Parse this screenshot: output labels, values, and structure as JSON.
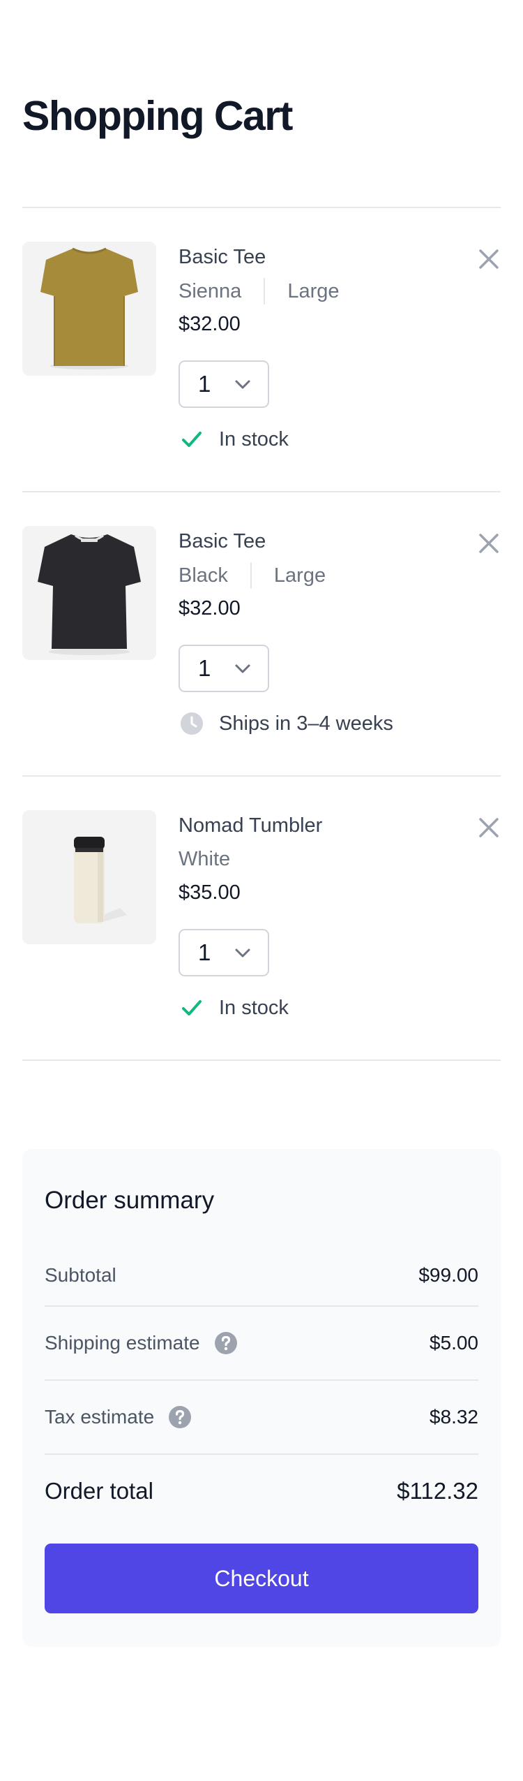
{
  "page": {
    "title": "Shopping Cart"
  },
  "cart": {
    "items": [
      {
        "name": "Basic Tee",
        "color": "Sienna",
        "size": "Large",
        "price": "$32.00",
        "quantity": "1",
        "availability": "In stock",
        "availability_icon": "check-icon",
        "image": "tshirt-sienna",
        "image_color": "#a58b3a"
      },
      {
        "name": "Basic Tee",
        "color": "Black",
        "size": "Large",
        "price": "$32.00",
        "quantity": "1",
        "availability": "Ships in 3–4 weeks",
        "availability_icon": "clock-icon",
        "image": "tshirt-black",
        "image_color": "#2a2a2e"
      },
      {
        "name": "Nomad Tumbler",
        "color": "White",
        "size": "",
        "price": "$35.00",
        "quantity": "1",
        "availability": "In stock",
        "availability_icon": "check-icon",
        "image": "tumbler-white",
        "image_color": "#efe9da"
      }
    ]
  },
  "summary": {
    "title": "Order summary",
    "subtotal_label": "Subtotal",
    "subtotal_value": "$99.00",
    "shipping_label": "Shipping estimate",
    "shipping_value": "$5.00",
    "tax_label": "Tax estimate",
    "tax_value": "$8.32",
    "total_label": "Order total",
    "total_value": "$112.32",
    "checkout_label": "Checkout"
  },
  "colors": {
    "accent": "#4f46e5",
    "in_stock": "#10b981",
    "muted_icon": "#d1d5db",
    "text_primary": "#111827",
    "text_secondary": "#6b7280",
    "panel_bg": "#f9fafb"
  }
}
